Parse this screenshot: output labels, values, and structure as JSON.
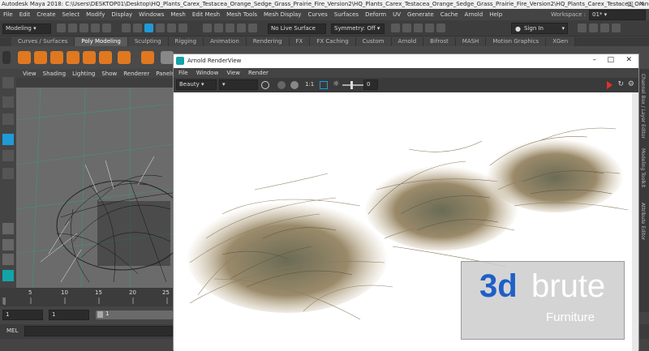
{
  "title": "Autodesk Maya 2018: C:\\Users\\DESKTOP01\\Desktop\\HQ_Plants_Carex_Testacea_Orange_Sedge_Grass_Prairie_Fire_Version2\\HQ_Plants_Carex_Testacea_Orange_Sedge_Grass_Prairie_Fire_Version2\\HQ_Plants_Carex_Testacea_Orang...",
  "menu": [
    "File",
    "Edit",
    "Create",
    "Select",
    "Modify",
    "Display",
    "Windows",
    "Mesh",
    "Edit Mesh",
    "Mesh Tools",
    "Mesh Display",
    "Curves",
    "Surfaces",
    "Deform",
    "UV",
    "Generate",
    "Cache",
    "Arnold",
    "Help"
  ],
  "workspace_label": "Workspace :",
  "workspace_value": "01*",
  "status": {
    "mode": "Modeling",
    "live_surface": "No Live Surface",
    "symmetry": "Symmetry: Off",
    "sign_in": "Sign In"
  },
  "shelf_tabs": [
    "Curves / Surfaces",
    "Poly Modeling",
    "Sculpting",
    "Rigging",
    "Animation",
    "Rendering",
    "FX",
    "FX Caching",
    "Custom",
    "Arnold",
    "Bifrost",
    "MASH",
    "Motion Graphics",
    "XGen"
  ],
  "shelf_active": "Poly Modeling",
  "viewport_menu": [
    "View",
    "Shading",
    "Lighting",
    "Show",
    "Renderer",
    "Panels"
  ],
  "timeline": {
    "ticks": [
      "5",
      "10",
      "15",
      "20",
      "25"
    ],
    "current": "1"
  },
  "range": {
    "start": "1",
    "start2": "1",
    "value": "1"
  },
  "mel_label": "MEL",
  "render_view": {
    "title": "Arnold RenderView",
    "menu": [
      "File",
      "Window",
      "View",
      "Render"
    ],
    "aov": "Beauty",
    "ratio": "1:1",
    "exposure": "0"
  },
  "side_tabs": [
    "Channel Box / Layer Editor",
    "Modeling Toolkit",
    "Attribute Editor"
  ],
  "watermark": {
    "brand_a": "3d",
    "brand_b": "brute",
    "sub": "Furniture"
  },
  "colors": {
    "accent": "#1e9bd7",
    "shelf_orange": "#e07820",
    "maya_teal": "#12a4a8"
  }
}
